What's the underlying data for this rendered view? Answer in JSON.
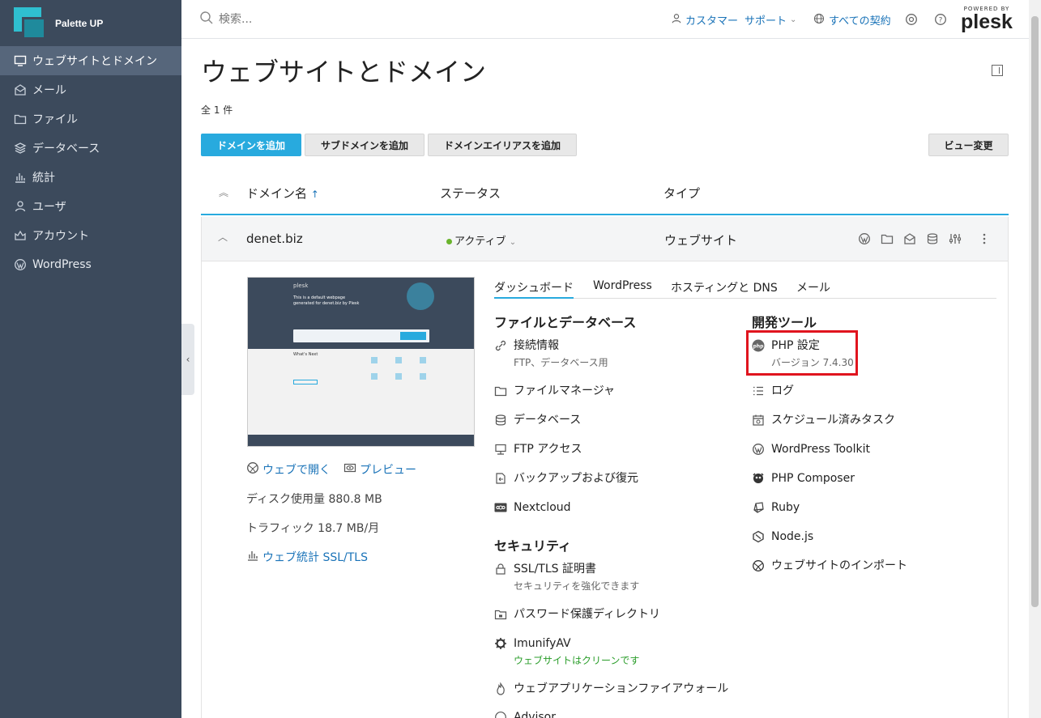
{
  "brand": {
    "name": "Palette UP"
  },
  "sidebar": {
    "items": [
      {
        "label": "ウェブサイトとドメイン",
        "icon": "monitor-icon",
        "active": true
      },
      {
        "label": "メール",
        "icon": "mail-icon"
      },
      {
        "label": "ファイル",
        "icon": "folder-icon"
      },
      {
        "label": "データベース",
        "icon": "database-icon"
      },
      {
        "label": "統計",
        "icon": "stats-icon"
      },
      {
        "label": "ユーザ",
        "icon": "user-icon"
      },
      {
        "label": "アカウント",
        "icon": "account-icon"
      },
      {
        "label": "WordPress",
        "icon": "wordpress-icon"
      }
    ]
  },
  "header": {
    "search_placeholder": "検索...",
    "customer": "カスタマー",
    "support": "サポート",
    "subscriptions": "すべての契約",
    "powered_by": "POWERED BY",
    "plesk": "plesk"
  },
  "page": {
    "title": "ウェブサイトとドメイン",
    "count": "全 1 件"
  },
  "toolbar": {
    "add_domain": "ドメインを追加",
    "add_subdomain": "サブドメインを追加",
    "add_alias": "ドメインエイリアスを追加",
    "change_view": "ビュー変更"
  },
  "table": {
    "col_domain": "ドメイン名",
    "col_status": "ステータス",
    "col_type": "タイプ",
    "sort_arrow": "↑"
  },
  "row": {
    "domain": "denet.biz",
    "status": "アクティブ",
    "type": "ウェブサイト"
  },
  "site": {
    "open_web": "ウェブで開く",
    "preview": "プレビュー",
    "disk_usage": "ディスク使用量 880.8 MB",
    "traffic": "トラフィック 18.7 MB/月",
    "web_stats": "ウェブ統計 SSL/TLS",
    "thumb_brand": "plesk",
    "thumb_heading": "This is a default webpage generated for denet.biz by Plesk",
    "thumb_whats_next": "What's Next"
  },
  "tabs": [
    "ダッシュボード",
    "WordPress",
    "ホスティングと DNS",
    "メール"
  ],
  "files_section": {
    "title": "ファイルとデータベース",
    "tools": [
      {
        "label": "接続情報",
        "sub": "FTP、データベース用",
        "icon": "link-icon"
      },
      {
        "label": "ファイルマネージャ",
        "icon": "folder-icon"
      },
      {
        "label": "データベース",
        "icon": "database-icon"
      },
      {
        "label": "FTP アクセス",
        "icon": "ftp-icon"
      },
      {
        "label": "バックアップおよび復元",
        "icon": "backup-icon"
      },
      {
        "label": "Nextcloud",
        "icon": "nextcloud-icon"
      }
    ]
  },
  "security_section": {
    "title": "セキュリティ",
    "tools": [
      {
        "label": "SSL/TLS 証明書",
        "sub": "セキュリティを強化できます",
        "icon": "lock-icon"
      },
      {
        "label": "パスワード保護ディレクトリ",
        "icon": "protected-folder-icon"
      },
      {
        "label": "ImunifyAV",
        "sub": "ウェブサイトはクリーンです",
        "icon": "imunify-icon"
      },
      {
        "label": "ウェブアプリケーションファイアウォール",
        "icon": "flame-icon"
      },
      {
        "label": "Advisor",
        "icon": "advisor-icon"
      }
    ]
  },
  "dev_section": {
    "title": "開発ツール",
    "tools": [
      {
        "label": "PHP 設定",
        "sub": "バージョン 7.4.30",
        "icon": "php-icon"
      },
      {
        "label": "ログ",
        "icon": "log-icon"
      },
      {
        "label": "スケジュール済みタスク",
        "icon": "calendar-icon"
      },
      {
        "label": "WordPress Toolkit",
        "icon": "wordpress-icon"
      },
      {
        "label": "PHP Composer",
        "icon": "composer-icon"
      },
      {
        "label": "Ruby",
        "icon": "ruby-icon"
      },
      {
        "label": "Node.js",
        "icon": "nodejs-icon"
      },
      {
        "label": "ウェブサイトのインポート",
        "icon": "import-icon"
      }
    ]
  },
  "colors": {
    "sidebar": "#3c4a5c",
    "accent": "#28aade",
    "link": "#1a73b8",
    "highlight": "#e0141e",
    "active_dot": "#6ab42d"
  }
}
